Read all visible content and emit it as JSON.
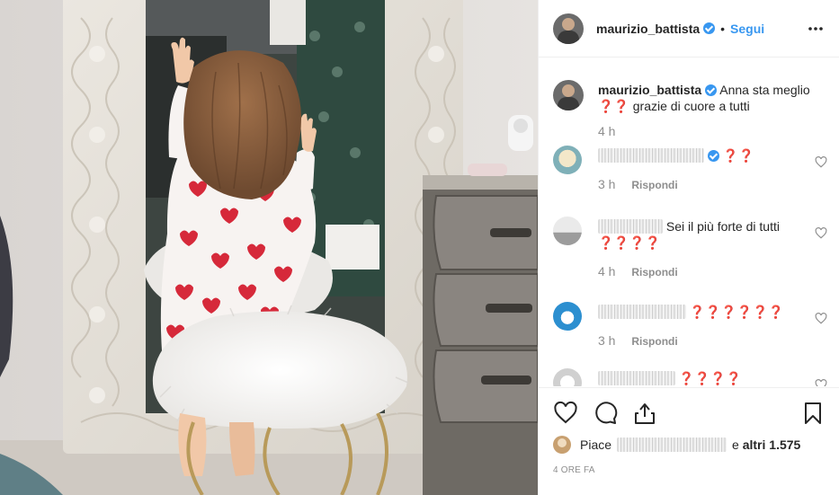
{
  "post": {
    "author": "maurizio_battista",
    "follow_label": "Segui",
    "caption_text": "Anna sta meglio",
    "caption_emoji": "❓❓",
    "caption_rest": " grazie di cuore a tutti",
    "caption_time": "4 h"
  },
  "comments": [
    {
      "text": "❓❓",
      "time": "3 h",
      "reply_label": "Rispondi",
      "verified": true
    },
    {
      "text": "Sei il più forte di tutti",
      "text_line2": "❓❓❓❓",
      "time": "4 h",
      "reply_label": "Rispondi",
      "verified": false
    },
    {
      "text": "❓❓❓❓❓❓",
      "time": "3 h",
      "reply_label": "Rispondi",
      "verified": false
    },
    {
      "text": "❓❓❓❓",
      "time": "",
      "reply_label": "",
      "verified": false
    }
  ],
  "likes": {
    "prefix": "Piace",
    "joiner": "e",
    "others": "altri 1.575"
  },
  "timestamp": "4 ORE FA",
  "icons": {
    "more": "more-options-icon",
    "like": "heart-icon",
    "comment": "comment-bubble-icon",
    "share": "share-icon",
    "save": "bookmark-icon",
    "verified": "verified-badge-icon"
  },
  "colors": {
    "accent": "#3897f0",
    "text": "#262626",
    "muted": "#8e8e8e",
    "border": "#efefef"
  }
}
